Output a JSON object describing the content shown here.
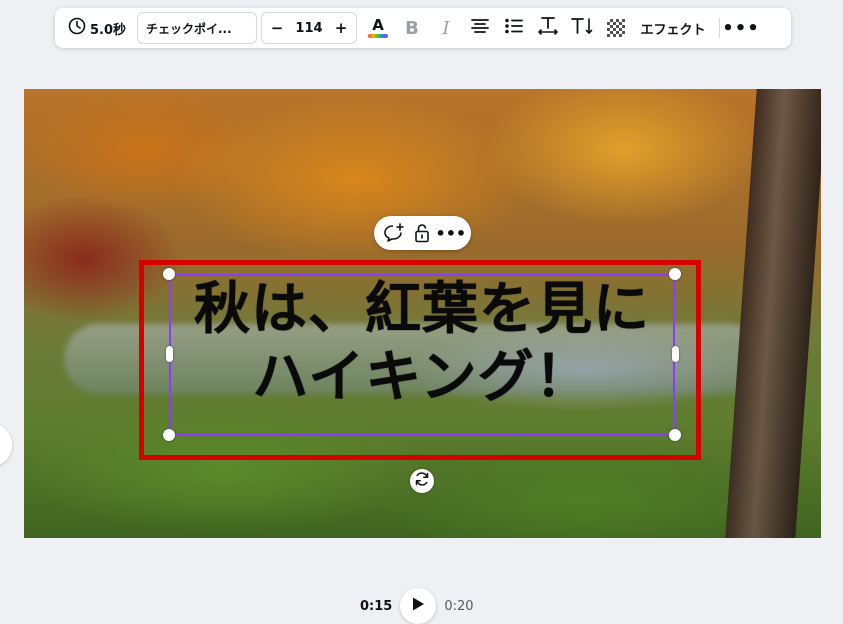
{
  "toolbar": {
    "duration": "5.0秒",
    "font_name": "チェックポイ...",
    "font_size": "114",
    "minus": "−",
    "plus": "+",
    "text_color_glyph": "A",
    "bold_glyph": "B",
    "italic_glyph": "I",
    "effect_label": "エフェクト",
    "more_glyph": "•••"
  },
  "canvas": {
    "headline_line1": "秋は、紅葉を見に",
    "headline_line2": "ハイキング！",
    "selection_color": "#8b3dff",
    "highlight_color": "#d60000"
  },
  "float_toolbar": {
    "more_glyph": "•••"
  },
  "playback": {
    "current_time": "0:15",
    "total_time": "0:20"
  },
  "icons": [
    "clock-icon",
    "text-color-icon",
    "bold-icon",
    "italic-icon",
    "align-center-icon",
    "list-icon",
    "letter-spacing-icon",
    "text-size-icon",
    "transparency-icon",
    "more-icon",
    "comment-add-icon",
    "lock-icon",
    "rotate-icon",
    "play-icon"
  ]
}
